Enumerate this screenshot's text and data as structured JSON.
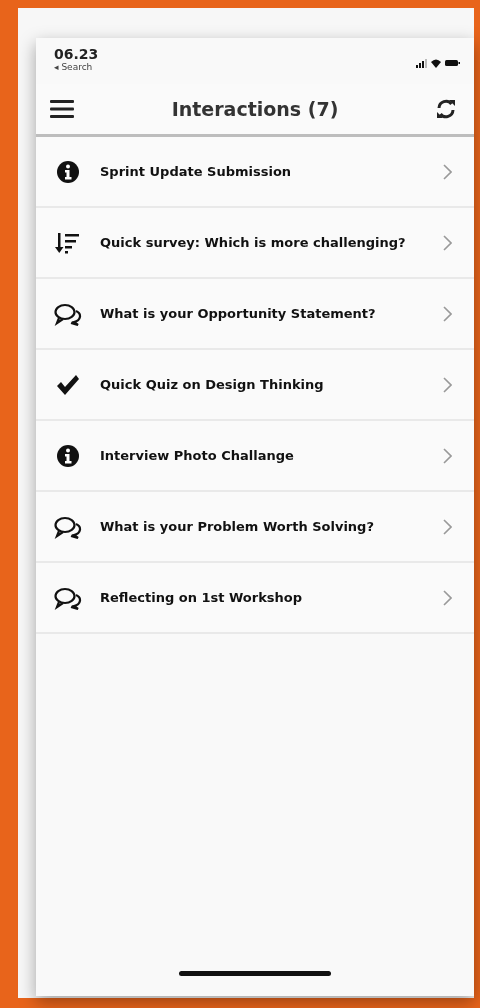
{
  "status_bar": {
    "time": "06.23",
    "back_label": "◂ Search"
  },
  "nav_bar": {
    "title": "Interactions (7)"
  },
  "items": [
    {
      "kind": "info",
      "label": "Sprint Update Submission"
    },
    {
      "kind": "sort",
      "label": "Quick survey: Which is more challenging?"
    },
    {
      "kind": "chat",
      "label": "What is your Opportunity Statement?"
    },
    {
      "kind": "check",
      "label": "Quick Quiz on Design Thinking"
    },
    {
      "kind": "info",
      "label": "Interview Photo Challange"
    },
    {
      "kind": "chat",
      "label": "What is your Problem Worth Solving?"
    },
    {
      "kind": "chat",
      "label": "Reflecting on 1st Workshop"
    }
  ]
}
